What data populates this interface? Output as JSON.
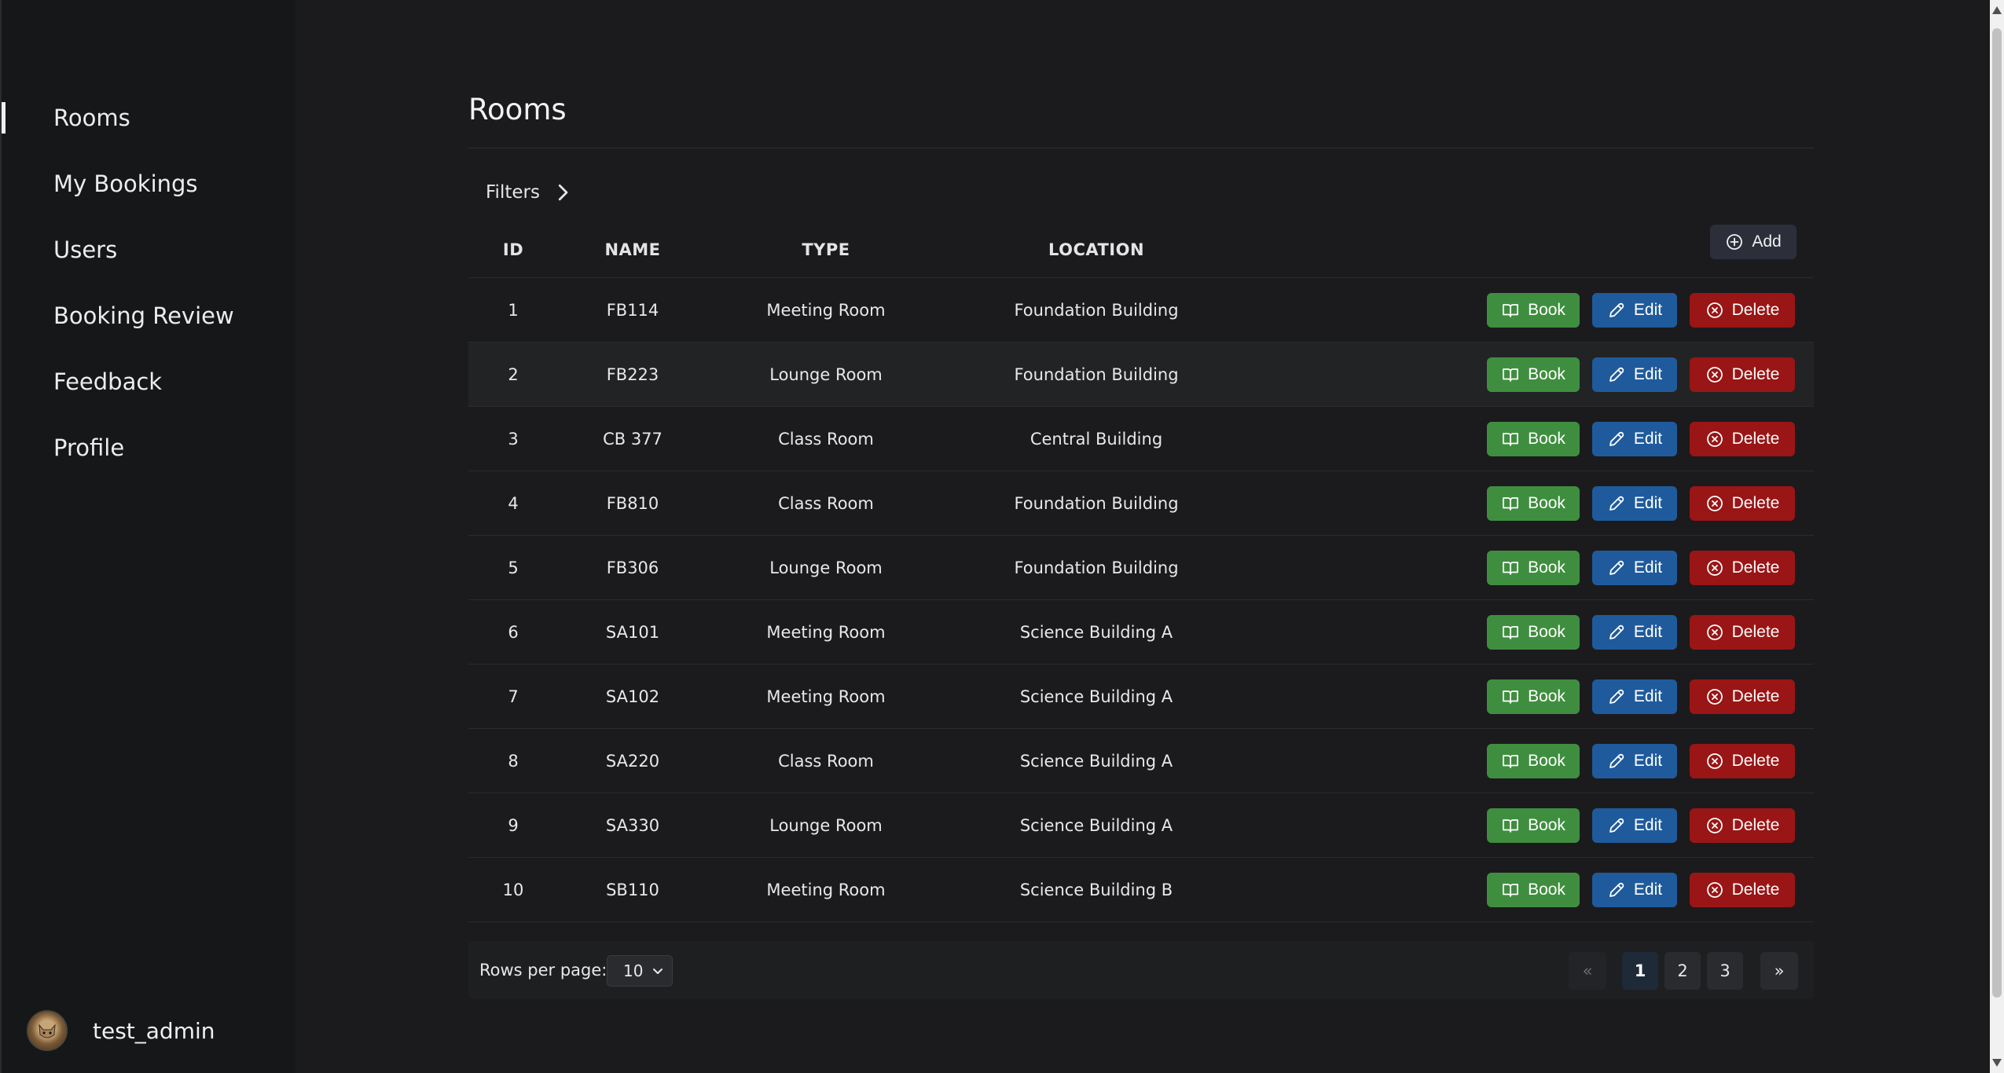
{
  "sidebar": {
    "items": [
      {
        "label": "Rooms"
      },
      {
        "label": "My Bookings"
      },
      {
        "label": "Users"
      },
      {
        "label": "Booking Review"
      },
      {
        "label": "Feedback"
      },
      {
        "label": "Profile"
      }
    ],
    "active": "Rooms",
    "user": {
      "name": "test_admin"
    }
  },
  "page": {
    "title": "Rooms",
    "filters_label": "Filters"
  },
  "table": {
    "headers": {
      "id": "ID",
      "name": "NAME",
      "type": "TYPE",
      "location": "LOCATION"
    },
    "add_label": "Add",
    "actions": {
      "book": "Book",
      "edit": "Edit",
      "delete": "Delete"
    },
    "rows": [
      {
        "id": "1",
        "name": "FB114",
        "type": "Meeting Room",
        "location": "Foundation Building"
      },
      {
        "id": "2",
        "name": "FB223",
        "type": "Lounge Room",
        "location": "Foundation Building"
      },
      {
        "id": "3",
        "name": "CB 377",
        "type": "Class Room",
        "location": "Central Building"
      },
      {
        "id": "4",
        "name": "FB810",
        "type": "Class Room",
        "location": "Foundation Building"
      },
      {
        "id": "5",
        "name": "FB306",
        "type": "Lounge Room",
        "location": "Foundation Building"
      },
      {
        "id": "6",
        "name": "SA101",
        "type": "Meeting Room",
        "location": "Science Building A"
      },
      {
        "id": "7",
        "name": "SA102",
        "type": "Meeting Room",
        "location": "Science Building A"
      },
      {
        "id": "8",
        "name": "SA220",
        "type": "Class Room",
        "location": "Science Building A"
      },
      {
        "id": "9",
        "name": "SA330",
        "type": "Lounge Room",
        "location": "Science Building A"
      },
      {
        "id": "10",
        "name": "SB110",
        "type": "Meeting Room",
        "location": "Science Building B"
      }
    ]
  },
  "pagination": {
    "rows_per_page_label": "Rows per page:",
    "rows_per_page_value": "10",
    "prev": "«",
    "pages": [
      "1",
      "2",
      "3"
    ],
    "current": "1",
    "next": "»"
  },
  "colors": {
    "book": "#3f8e3f",
    "edit": "#1f5b9c",
    "delete": "#9a1515",
    "background": "#1b1b1d",
    "sidebar": "#161719"
  }
}
